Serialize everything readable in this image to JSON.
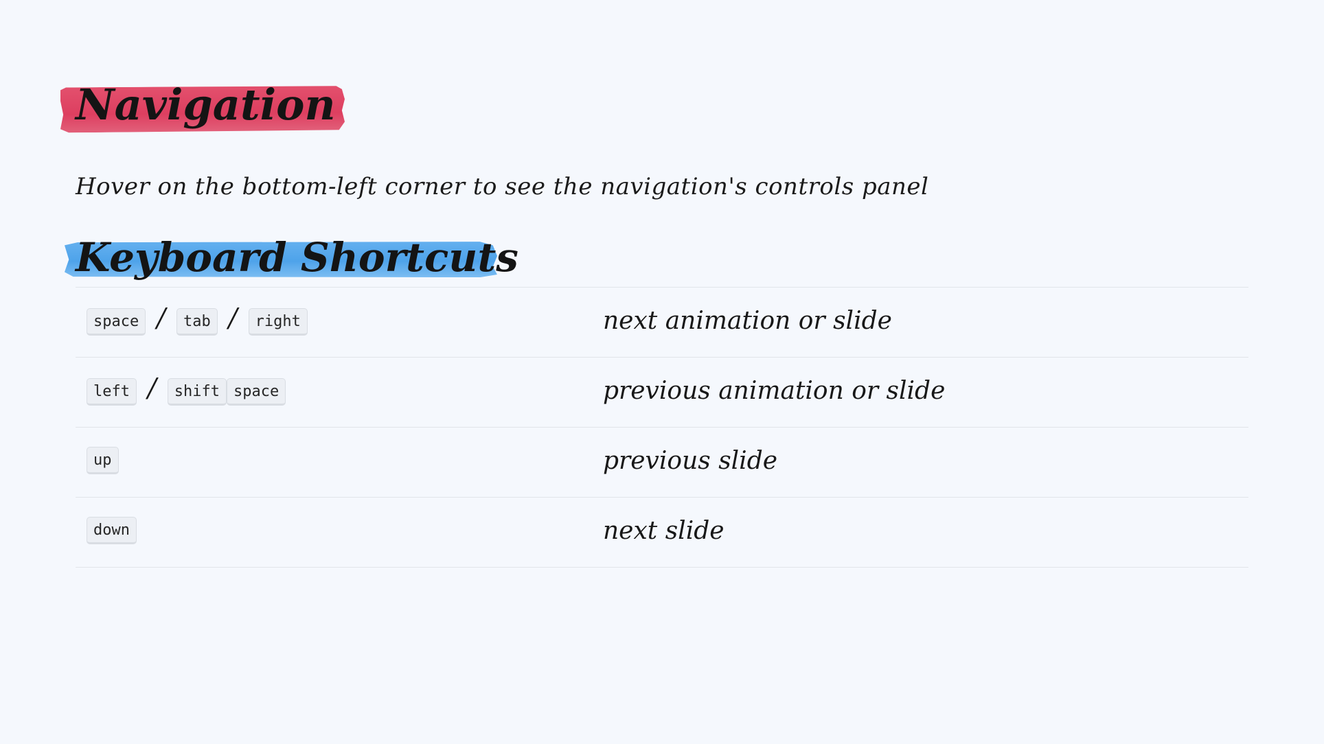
{
  "navigation": {
    "heading": "Navigation",
    "description": "Hover on the bottom-left corner to see the navigation's controls panel",
    "highlight_color": "#dd3f60"
  },
  "keyboard_shortcuts": {
    "heading": "Keyboard Shortcuts",
    "highlight_color": "#4ea3ea",
    "separator": "/",
    "rows": [
      {
        "keys": [
          [
            "space"
          ],
          [
            "tab"
          ],
          [
            "right"
          ]
        ],
        "action": "next animation or slide"
      },
      {
        "keys": [
          [
            "left"
          ],
          [
            "shift",
            "space"
          ]
        ],
        "action": "previous animation or slide"
      },
      {
        "keys": [
          [
            "up"
          ]
        ],
        "action": "previous slide"
      },
      {
        "keys": [
          [
            "down"
          ]
        ],
        "action": "next slide"
      }
    ]
  }
}
